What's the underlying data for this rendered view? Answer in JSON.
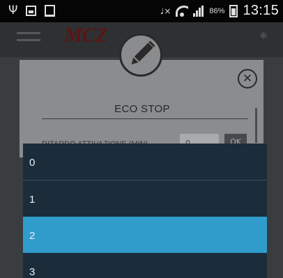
{
  "status_bar": {
    "battery_percent": "86%",
    "time": "13:15",
    "icons": [
      "usb-icon",
      "screenshot-icon",
      "gallery-icon",
      "mute-icon",
      "wifi-icon",
      "signal-icon",
      "battery-icon"
    ]
  },
  "app": {
    "brand": "MCZ"
  },
  "dialog": {
    "title": "ECO STOP",
    "delay_label": "RITARDO ATTIVAZIONE (MIN)",
    "field_value": "0",
    "ok_label": "OK",
    "icons": [
      "pencil-icon",
      "close-icon"
    ]
  },
  "dropdown": {
    "options": [
      "0",
      "1",
      "2",
      "3"
    ],
    "selected_index": 2
  },
  "colors": {
    "list_bg": "#1b2c3a",
    "selected": "#2f9ccc",
    "overlay": "#3a3d3f"
  }
}
